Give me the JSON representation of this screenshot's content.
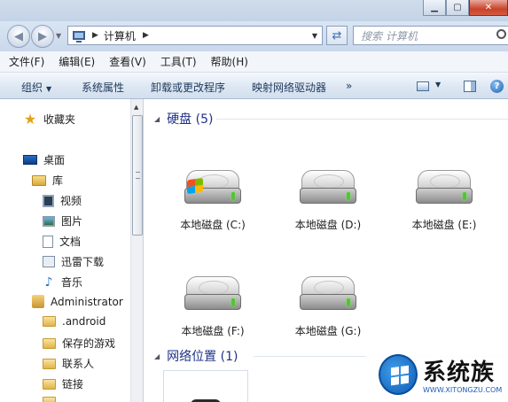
{
  "address": {
    "crumb": "计算机",
    "search_placeholder": "搜索 计算机"
  },
  "menu": [
    "文件(F)",
    "编辑(E)",
    "查看(V)",
    "工具(T)",
    "帮助(H)"
  ],
  "toolbar": {
    "organize": "组织",
    "system_properties": "系统属性",
    "uninstall": "卸载或更改程序",
    "map_drive": "映射网络驱动器",
    "more": "»"
  },
  "nav": {
    "favorites": "收藏夹",
    "desktop": "桌面",
    "libraries": "库",
    "videos": "视频",
    "pictures": "图片",
    "documents": "文档",
    "thunder": "迅雷下载",
    "music": "音乐",
    "user": "Administrator",
    "android": ".android",
    "saved_games": "保存的游戏",
    "contacts": "联系人",
    "links": "链接"
  },
  "groups": {
    "hdd": "硬盘 (5)",
    "network": "网络位置 (1)"
  },
  "drives": [
    {
      "label": "本地磁盘 (C:)",
      "system": true
    },
    {
      "label": "本地磁盘 (D:)",
      "system": false
    },
    {
      "label": "本地磁盘 (E:)",
      "system": false
    },
    {
      "label": "本地磁盘 (F:)",
      "system": false
    },
    {
      "label": "本地磁盘 (G:)",
      "system": false
    }
  ],
  "watermark": {
    "brand": "系统族",
    "url": "WWW.XITONGZU.COM"
  }
}
